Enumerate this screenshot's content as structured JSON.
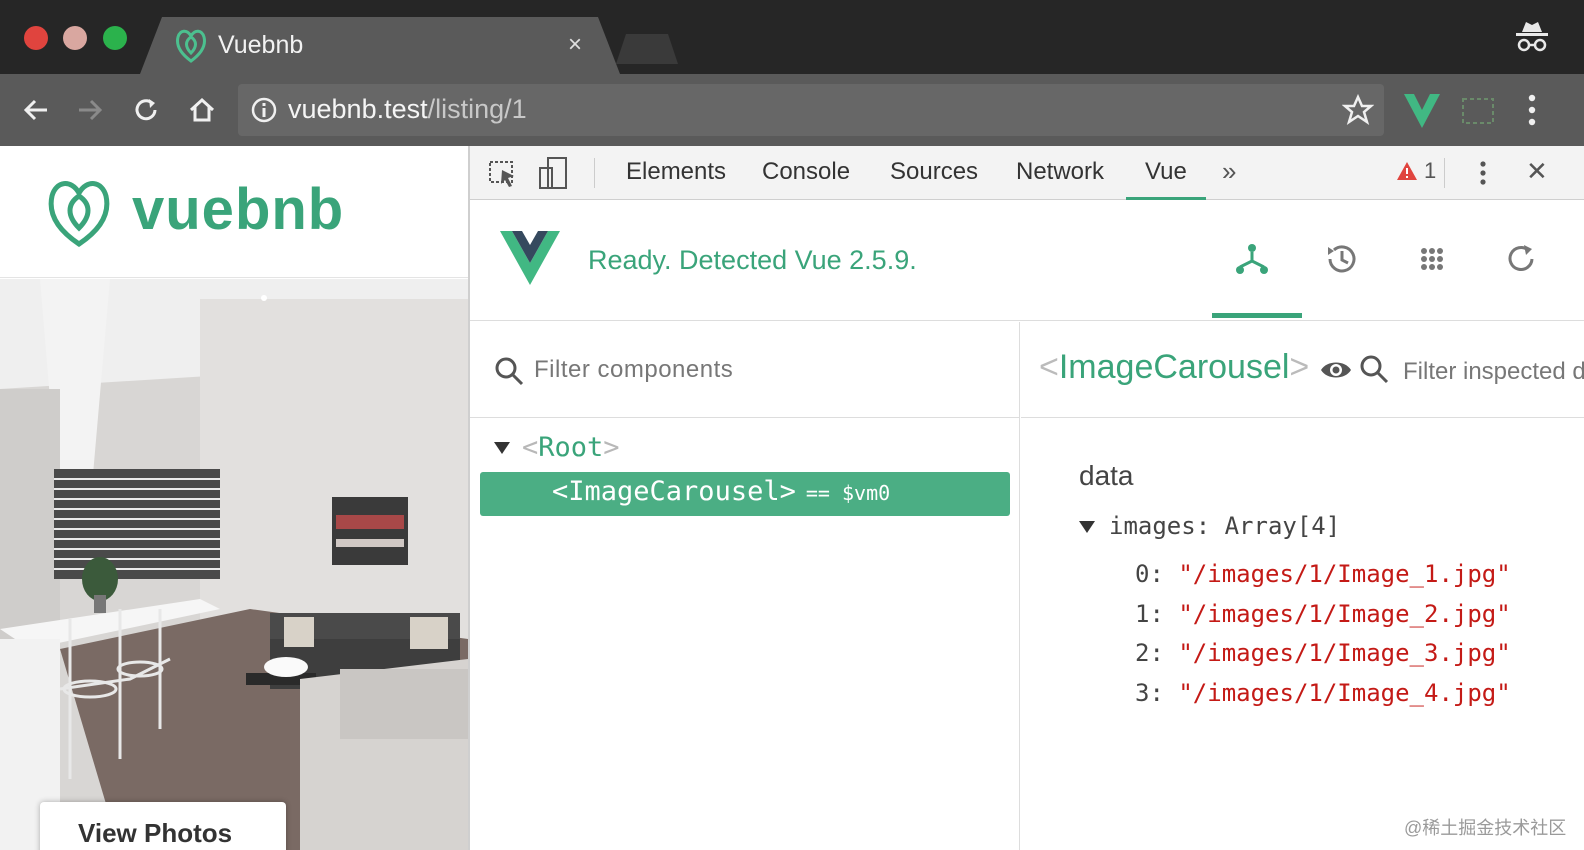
{
  "browser": {
    "tab_title": "Vuebnb",
    "tab_close": "×",
    "url_host": "vuebnb.test",
    "url_path": "/listing/1"
  },
  "page": {
    "logo_text": "vuebnb",
    "view_photos_label": "View Photos"
  },
  "devtools": {
    "tabs": [
      "Elements",
      "Console",
      "Sources",
      "Network",
      "Vue"
    ],
    "active_tab": "Vue",
    "more_label": "»",
    "warning_count": "1",
    "close": "✕"
  },
  "vue": {
    "status": "Ready. Detected Vue 2.5.9.",
    "filter_placeholder": "Filter components",
    "tree": {
      "root": "Root",
      "child": "ImageCarousel",
      "vm_ref": "== $vm0"
    },
    "inspector": {
      "component_name": "ImageCarousel",
      "filter_placeholder": "Filter inspected data",
      "section_title": "data",
      "prop_name": "images:",
      "prop_type": "Array[4]",
      "items": [
        {
          "index": "0:",
          "value": "\"/images/1/Image_1.jpg\""
        },
        {
          "index": "1:",
          "value": "\"/images/1/Image_2.jpg\""
        },
        {
          "index": "2:",
          "value": "\"/images/1/Image_3.jpg\""
        },
        {
          "index": "3:",
          "value": "\"/images/1/Image_4.jpg\""
        }
      ]
    }
  },
  "watermark": "@稀土掘金技术社区",
  "colors": {
    "vue_green": "#3aa47a",
    "selected_row": "#4bae84",
    "string_red": "#c41a16",
    "chrome_dark": "#262626",
    "chrome_toolbar": "#5a5a5a"
  }
}
